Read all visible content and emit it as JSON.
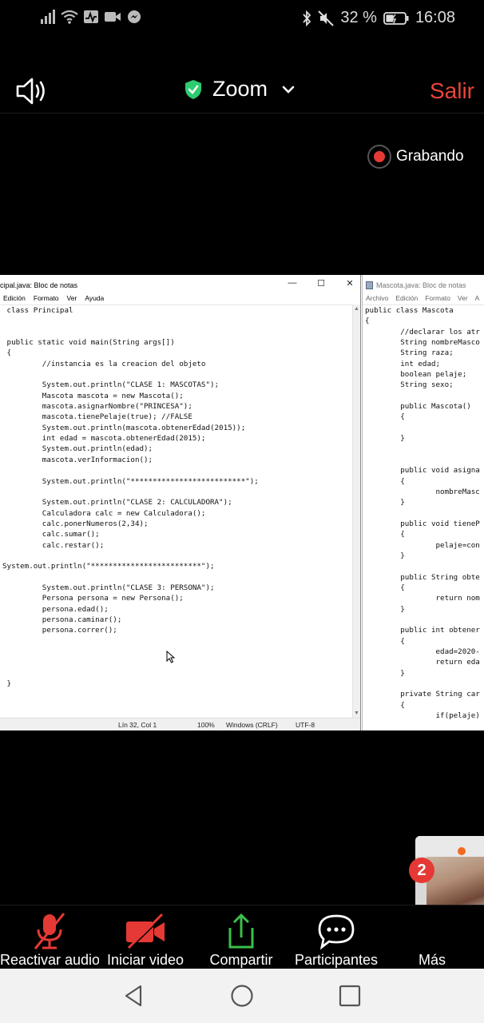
{
  "statusbar": {
    "battery_percent": "32 %",
    "time": "16:08"
  },
  "header": {
    "app_title": "Zoom",
    "leave_label": "Salir",
    "recording_label": "Grabando"
  },
  "notepad_main": {
    "title": "cipal.java: Bloc de notas",
    "menu": [
      "Edición",
      "Formato",
      "Ver",
      "Ayuda"
    ],
    "content": " class Principal\n\n\n public static void main(String args[])\n {\n         //instancia es la creacion del objeto\n\n         System.out.println(\"CLASE 1: MASCOTAS\");\n         Mascota mascota = new Mascota();\n         mascota.asignarNombre(\"PRINCESA\");\n         mascota.tienePelaje(true); //FALSE\n         System.out.println(mascota.obtenerEdad(2015));\n         int edad = mascota.obtenerEdad(2015);\n         System.out.println(edad);\n         mascota.verInformacion();\n\n         System.out.println(\"**************************\");\n\n         System.out.println(\"CLASE 2: CALCULADORA\");\n         Calculadora calc = new Calculadora();\n         calc.ponerNumeros(2,34);\n         calc.sumar();\n         calc.restar();\n\nSystem.out.println(\"*************************\");\n\n         System.out.println(\"CLASE 3: PERSONA\");\n         Persona persona = new Persona();\n         persona.edad();\n         persona.caminar();\n         persona.correr();\n\n\n\n\n }",
    "status_position": "Lín 32, Col 1",
    "status_zoom": "100%",
    "status_lineend": "Windows (CRLF)",
    "status_encoding": "UTF-8"
  },
  "notepad_side": {
    "title": "Mascota.java: Bloc de notas",
    "menu": [
      "Archivo",
      "Edición",
      "Formato",
      "Ver",
      "A"
    ],
    "content": "public class Mascota\n{\n        //declarar los atr\n        String nombreMasco\n        String raza;\n        int edad;\n        boolean pelaje;\n        String sexo;\n\n        public Mascota()\n        {\n\n        }\n\n\n        public void asigna\n        {\n                nombreMasc\n        }\n\n        public void tieneP\n        {\n                pelaje=con\n        }\n\n        public String obte\n        {\n                return nom\n        }\n\n        public int obtener\n        {\n                edad=2020-\n                return eda\n        }\n\n        private String car\n        {\n                if(pelaje)"
  },
  "participants_count": "2",
  "toolbar": {
    "unmute_label": "Reactivar audio",
    "video_label": "Iniciar video",
    "share_label": "Compartir",
    "participants_label": "Participantes",
    "more_label": "Más"
  },
  "colors": {
    "leave": "#e8453c",
    "shield": "#2ecc71",
    "record": "#e53935",
    "share_icon": "#3bbf4a",
    "muted": "#e53935"
  }
}
